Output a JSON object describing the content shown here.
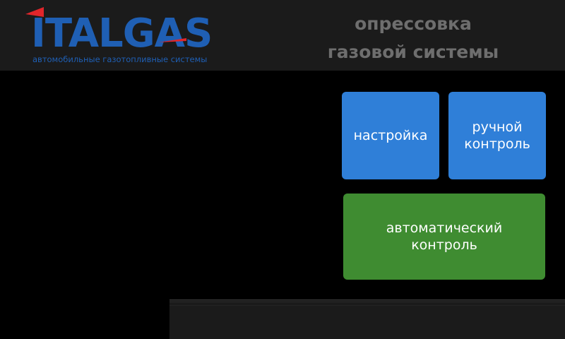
{
  "header": {
    "logo": {
      "wordmark": "ITALGAS",
      "tagline": "автомобильные газотопливные системы"
    },
    "title_line1": "опрессовка",
    "title_line2": "газовой системы"
  },
  "buttons": {
    "setup": {
      "label": "настройка"
    },
    "manual": {
      "line1": "ручной",
      "line2": "контроль"
    },
    "auto": {
      "line1": "автоматический",
      "line2": "контроль"
    }
  },
  "colors": {
    "header_bg": "#1b1b1b",
    "background": "#000000",
    "logo_blue": "#1f5fb4",
    "logo_red": "#e0262b",
    "title_gray": "#6e6e6e",
    "button_blue": "#2f7fd8",
    "button_green": "#3f8c31"
  }
}
